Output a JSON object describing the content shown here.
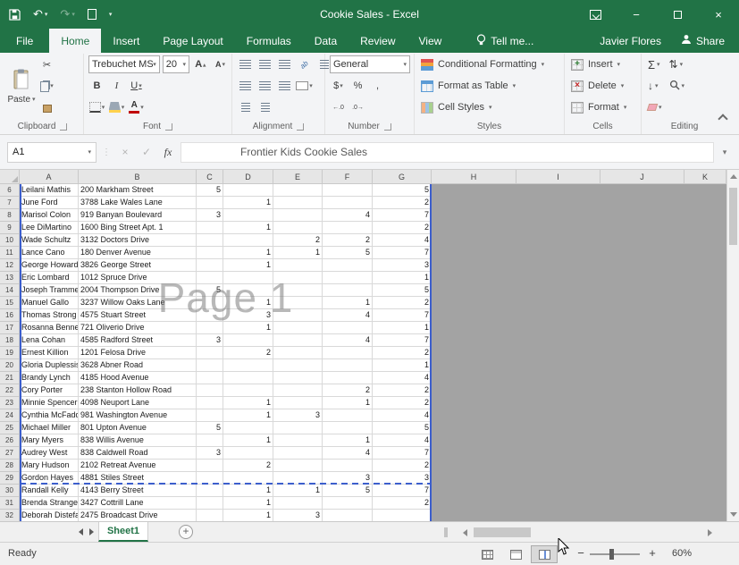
{
  "window": {
    "title": "Cookie Sales - Excel"
  },
  "tabs": {
    "file": "File",
    "items": [
      "Home",
      "Insert",
      "Page Layout",
      "Formulas",
      "Data",
      "Review",
      "View"
    ],
    "active": "Home"
  },
  "tell_me": "Tell me...",
  "account": "Javier Flores",
  "share": "Share",
  "icons": {
    "chevron_down": "▾",
    "scissors": "✂",
    "undo": "↶",
    "redo": "↷",
    "sigma": "Σ",
    "fill_down": "↓",
    "sort": "⇅",
    "close": "×",
    "check": "✓",
    "dollar": "$",
    "percent": "%",
    "comma": ",",
    "dec_increase": "←.0",
    "dec_decrease": ".0→",
    "letter_a": "A",
    "minus": "−",
    "plus": "+",
    "minimize": "−",
    "ab": "ab"
  },
  "ribbon": {
    "font_name": "Trebuchet MS",
    "font_size": "20",
    "bold": "B",
    "italic": "I",
    "underline": "U",
    "number_format": "General",
    "paste": "Paste",
    "styles_buttons": [
      "Conditional Formatting",
      "Format as Table",
      "Cell Styles"
    ],
    "cells_buttons": [
      "Insert",
      "Delete",
      "Format"
    ],
    "group_labels": [
      "Clipboard",
      "Font",
      "Alignment",
      "Number",
      "Styles",
      "Cells",
      "Editing"
    ]
  },
  "formula_bar": {
    "name_box": "A1",
    "fx": "fx",
    "value": "Frontier Kids Cookie Sales"
  },
  "grid": {
    "watermark": "Page 1",
    "columns": [
      "A",
      "B",
      "C",
      "D",
      "E",
      "F",
      "G",
      "H",
      "I",
      "J",
      "K"
    ],
    "page_break_after_row": 29,
    "rows": [
      {
        "n": "6",
        "name": "Leilani Mathis",
        "address": "200 Markham Street",
        "c": "5",
        "d": "",
        "e": "",
        "f": "",
        "g": "5"
      },
      {
        "n": "7",
        "name": "June Ford",
        "address": "3788 Lake Wales Lane",
        "c": "",
        "d": "1",
        "e": "",
        "f": "",
        "g": "2"
      },
      {
        "n": "8",
        "name": "Marisol Colon",
        "address": "919 Banyan Boulevard",
        "c": "3",
        "d": "",
        "e": "",
        "f": "4",
        "g": "7"
      },
      {
        "n": "9",
        "name": "Lee DiMartino",
        "address": "1600 Bing Street Apt. 1",
        "c": "",
        "d": "1",
        "e": "",
        "f": "",
        "g": "2"
      },
      {
        "n": "10",
        "name": "Wade Schultz",
        "address": "3132 Doctors Drive",
        "c": "",
        "d": "",
        "e": "2",
        "f": "2",
        "g": "4"
      },
      {
        "n": "11",
        "name": "Lance Cano",
        "address": "180 Denver Avenue",
        "c": "",
        "d": "1",
        "e": "1",
        "f": "5",
        "g": "7"
      },
      {
        "n": "12",
        "name": "George Howard",
        "address": "3826 George Street",
        "c": "",
        "d": "1",
        "e": "",
        "f": "",
        "g": "3"
      },
      {
        "n": "13",
        "name": "Eric Lombard",
        "address": "1012 Spruce Drive",
        "c": "",
        "d": "",
        "e": "",
        "f": "",
        "g": "1"
      },
      {
        "n": "14",
        "name": "Joseph Trammell",
        "address": "2004 Thompson Drive",
        "c": "5",
        "d": "",
        "e": "",
        "f": "",
        "g": "5"
      },
      {
        "n": "15",
        "name": "Manuel Gallo",
        "address": "3237 Willow Oaks Lane",
        "c": "",
        "d": "1",
        "e": "",
        "f": "1",
        "g": "2"
      },
      {
        "n": "16",
        "name": "Thomas Strong",
        "address": "4575 Stuart Street",
        "c": "",
        "d": "3",
        "e": "",
        "f": "4",
        "g": "7"
      },
      {
        "n": "17",
        "name": "Rosanna Bennett",
        "address": "721 Oliverio Drive",
        "c": "",
        "d": "1",
        "e": "",
        "f": "",
        "g": "1"
      },
      {
        "n": "18",
        "name": "Lena Cohan",
        "address": "4585 Radford Street",
        "c": "3",
        "d": "",
        "e": "",
        "f": "4",
        "g": "7"
      },
      {
        "n": "19",
        "name": "Ernest Killion",
        "address": "1201 Felosa Drive",
        "c": "",
        "d": "2",
        "e": "",
        "f": "",
        "g": "2"
      },
      {
        "n": "20",
        "name": "Gloria Duplessis",
        "address": "3628 Abner Road",
        "c": "",
        "d": "",
        "e": "",
        "f": "",
        "g": "1"
      },
      {
        "n": "21",
        "name": "Brandy Lynch",
        "address": "4185 Hood Avenue",
        "c": "",
        "d": "",
        "e": "",
        "f": "",
        "g": "4"
      },
      {
        "n": "22",
        "name": "Cory Porter",
        "address": "238 Stanton Hollow Road",
        "c": "",
        "d": "",
        "e": "",
        "f": "2",
        "g": "2"
      },
      {
        "n": "23",
        "name": "Minnie Spencer",
        "address": "4098 Neuport Lane",
        "c": "",
        "d": "1",
        "e": "",
        "f": "1",
        "g": "2"
      },
      {
        "n": "24",
        "name": "Cynthia McFadden",
        "address": "981 Washington Avenue",
        "c": "",
        "d": "1",
        "e": "3",
        "f": "",
        "g": "4"
      },
      {
        "n": "25",
        "name": "Michael Miller",
        "address": "801 Upton Avenue",
        "c": "5",
        "d": "",
        "e": "",
        "f": "",
        "g": "5"
      },
      {
        "n": "26",
        "name": "Mary Myers",
        "address": "838 Willis Avenue",
        "c": "",
        "d": "1",
        "e": "",
        "f": "1",
        "g": "4"
      },
      {
        "n": "27",
        "name": "Audrey West",
        "address": "838 Caldwell Road",
        "c": "3",
        "d": "",
        "e": "",
        "f": "4",
        "g": "7"
      },
      {
        "n": "28",
        "name": "Mary Hudson",
        "address": "2102 Retreat Avenue",
        "c": "",
        "d": "2",
        "e": "",
        "f": "",
        "g": "2"
      },
      {
        "n": "29",
        "name": "Gordon Hayes",
        "address": "4881 Stiles Street",
        "c": "",
        "d": "",
        "e": "",
        "f": "3",
        "g": "3"
      },
      {
        "n": "30",
        "name": "Randall Kelly",
        "address": "4143 Berry Street",
        "c": "",
        "d": "1",
        "e": "1",
        "f": "5",
        "g": "7"
      },
      {
        "n": "31",
        "name": "Brenda Strange",
        "address": "3427 Cottrill Lane",
        "c": "",
        "d": "1",
        "e": "",
        "f": "",
        "g": "2"
      },
      {
        "n": "32",
        "name": "Deborah Distefano",
        "address": "2475 Broadcast Drive",
        "c": "",
        "d": "1",
        "e": "3",
        "f": "",
        "g": ""
      }
    ]
  },
  "sheet_bar": {
    "active_tab": "Sheet1"
  },
  "status_bar": {
    "ready": "Ready",
    "zoom": "60%"
  }
}
